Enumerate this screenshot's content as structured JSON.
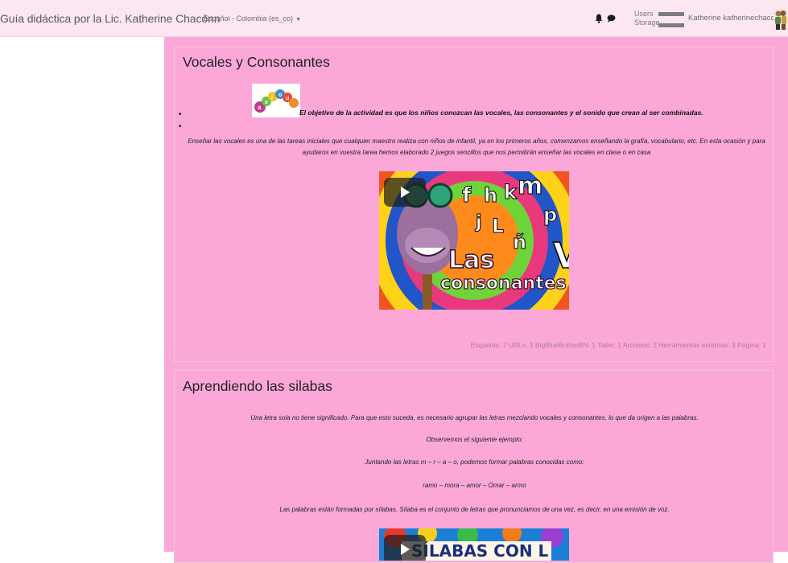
{
  "navbar": {
    "site_title": "Guía didáctica por la Lic. Katherine Chacónn",
    "language": "Español - Colombia (es_co)",
    "quota": {
      "users_label": "Users",
      "storage_label": "Storage",
      "users_fraction": 0.82,
      "storage_fraction": 0.82
    },
    "user_name": "Katherine katherinechacon"
  },
  "sections": [
    {
      "title": "Vocales y Consonantes",
      "objective": "El objetivo de la actividad es que los niños conozcan las vocales, las consonantes y el sonido que crean al ser combinadas.",
      "paragraph": "Enseñar las vocales es una de las tareas iniciales que cualquier maestro realiza con niños de infantil, ya en los primeros años, comenzamos enseñando la grafía, vocabulario, etc. En esta ocasión y para ayudaros en vuestra tarea hemos elaborado 2 juegos sencillos que nos permitirán enseñar las vocales en clase o en casa",
      "video": {
        "thumbnail_text": "Las consonantes",
        "letters": "f h k m j L ñ p V"
      },
      "activity_counts": "Etiquetas: 7  URLs: 3  BigBlueButtonBN: 1  Taller: 1  Archivos: 2  Herramientas externas: 3  Página: 1"
    },
    {
      "title": "Aprendiendo las silabas",
      "paragraphs": [
        "Una letra sola no tiene significado. Para que esto suceda, es necesario agrupar las letras mezclando vocales y consonantes, lo que da origen a las palabras.",
        "Observemos el siguiente ejemplo:",
        "Juntando las letras m – r – a – o, podemos formar palabras conocidas como:",
        "ramo – mora – amor – Omar – armo",
        "Las palabras están formadas por sílabas. Sílaba es el conjunto de letras que pronunciamos de una vez, es decir, en una emisión de voz."
      ],
      "video": {
        "thumbnail_text": "SILABAS CON L"
      }
    }
  ],
  "colors": {
    "navbar_bg": "#fce6f1",
    "main_bg": "#fba8d8",
    "section_border": "#f0c6de"
  },
  "icons": [
    "bell-icon",
    "chat-icon",
    "avatar",
    "play-icon",
    "caret-down-icon"
  ]
}
